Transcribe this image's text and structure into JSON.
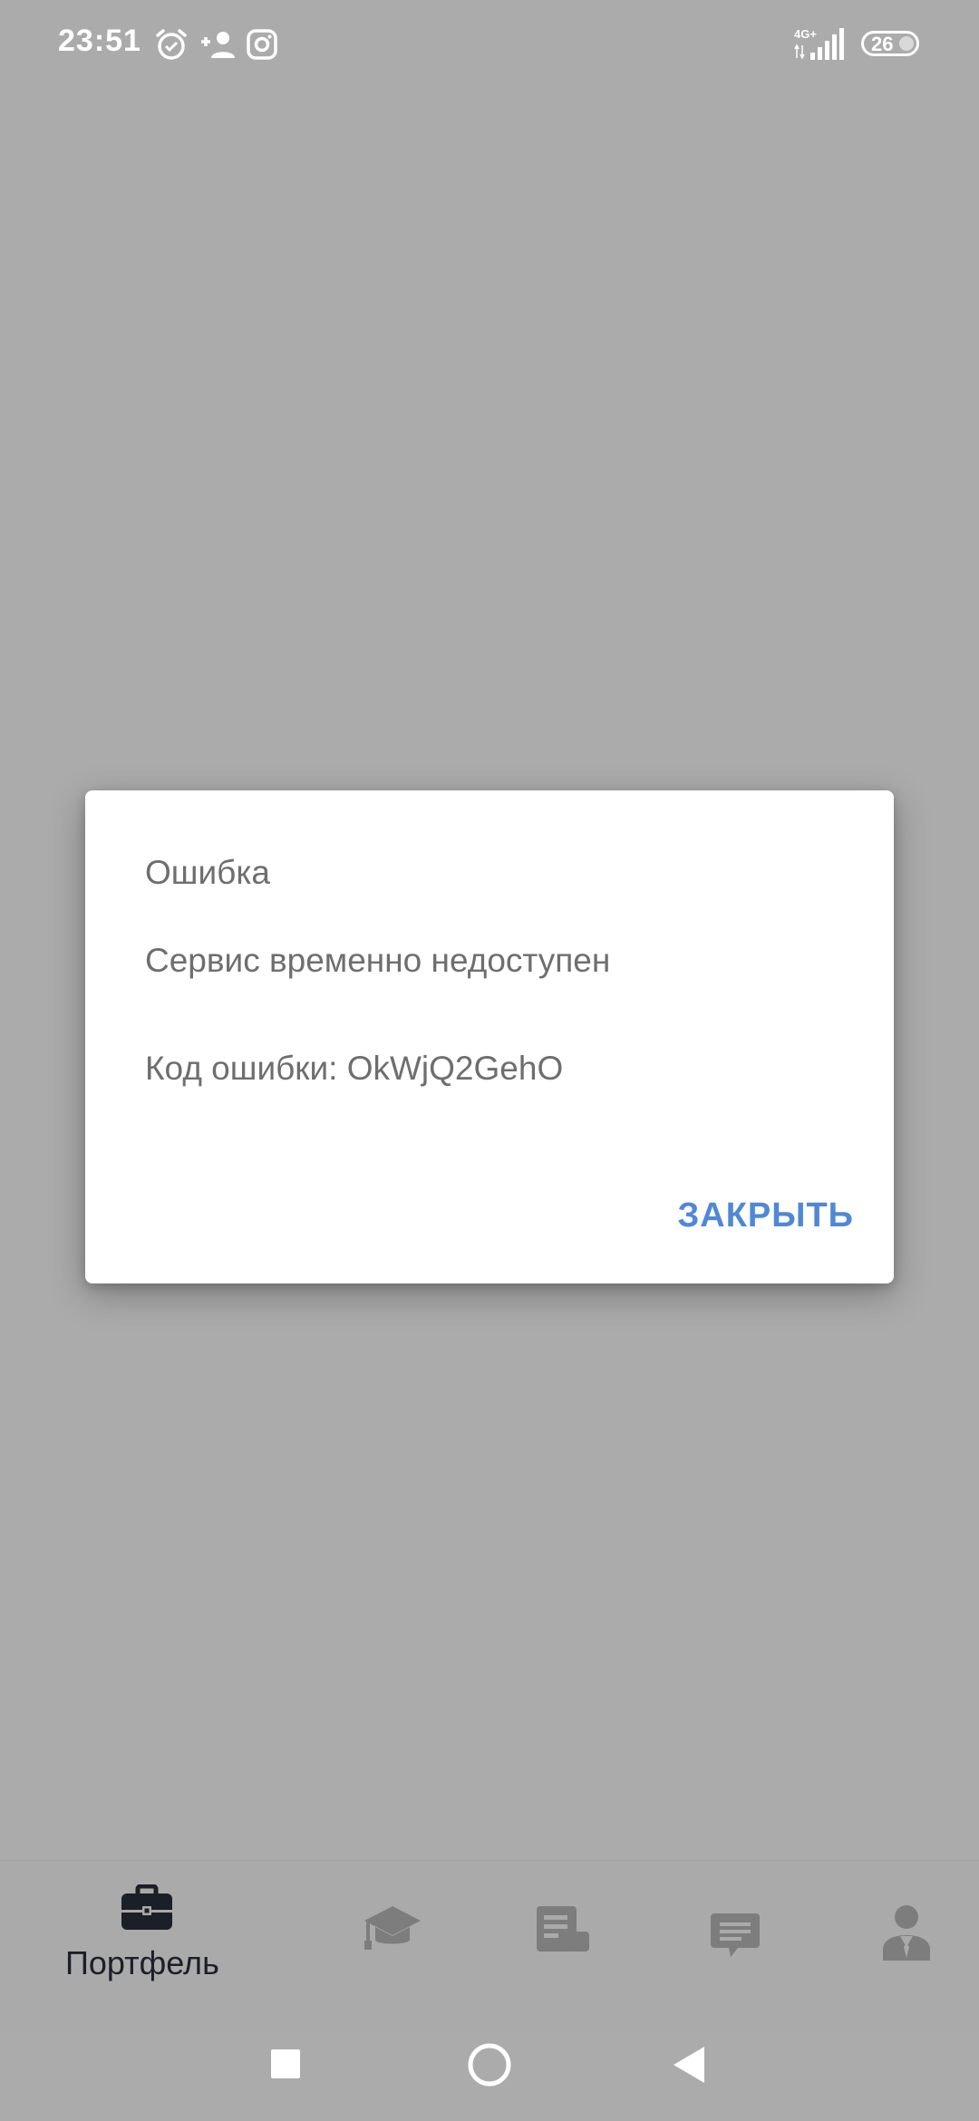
{
  "status_bar": {
    "time": "23:51",
    "network": "4G+",
    "battery": "26",
    "icons": [
      "alarm-icon",
      "add-contact-icon",
      "instagram-icon",
      "signal-icon",
      "battery-icon"
    ]
  },
  "dialog": {
    "title": "Ошибка",
    "message": "Сервис временно недоступен",
    "code_text": "Код ошибки: OkWjQ2GehO",
    "close_label": "ЗАКРЫТЬ",
    "accent_color": "#5088d6"
  },
  "bottom_nav": {
    "items": [
      {
        "label": "Портфель",
        "icon": "briefcase-icon",
        "active": true
      },
      {
        "label": "",
        "icon": "graduation-cap-icon",
        "active": false
      },
      {
        "label": "",
        "icon": "document-icon",
        "active": false
      },
      {
        "label": "",
        "icon": "chat-icon",
        "active": false
      },
      {
        "label": "",
        "icon": "profile-icon",
        "active": false
      }
    ]
  },
  "system_nav": {
    "icons": [
      "recent-apps-icon",
      "home-icon",
      "back-icon"
    ]
  },
  "colors": {
    "scrim_background": "#ababab",
    "dialog_text": "#6e6e6e",
    "active_nav": "#1b1f27",
    "inactive_nav": "#7d7d7d"
  }
}
